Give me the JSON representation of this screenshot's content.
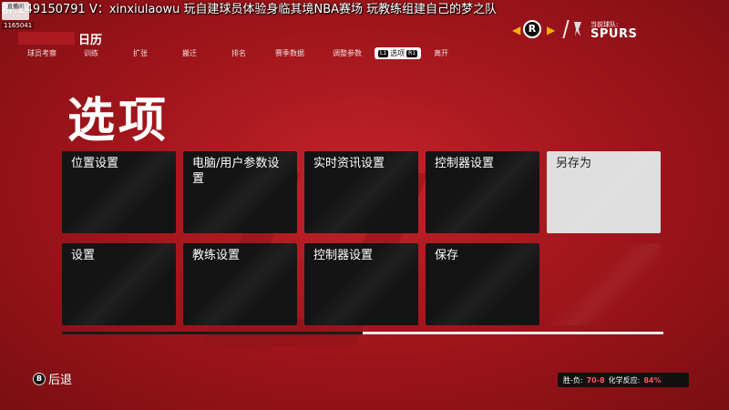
{
  "stream": {
    "banner": "群:249150791 V：xinxiulaowu   玩自建球员体验身临其境NBA赛场  玩教练组建自己的梦之队",
    "badge": "直播间",
    "room_id": "1165041"
  },
  "breadcrumb": {
    "current": "日历"
  },
  "nav": {
    "items": [
      {
        "label": "球员考察"
      },
      {
        "label": "训练"
      },
      {
        "label": "扩张"
      },
      {
        "label": "搬迁"
      },
      {
        "label": "排名"
      },
      {
        "label": "赛季数据"
      },
      {
        "label": "调整参数"
      },
      {
        "label": "选项",
        "active": true,
        "key_left": "L1",
        "key_right": "R1"
      },
      {
        "label": "离开"
      }
    ]
  },
  "team": {
    "label": "当前球队:",
    "name": "SPURS",
    "logo_letter": "R",
    "prev_arrow": "◀",
    "next_arrow": "▶"
  },
  "page": {
    "title": "选项"
  },
  "tiles": [
    {
      "label": "位置设置"
    },
    {
      "label": "电脑/用户参数设置"
    },
    {
      "label": "实时资讯设置"
    },
    {
      "label": "控制器设置"
    },
    {
      "label": "另存为",
      "selected": true
    },
    {
      "label": "设置"
    },
    {
      "label": "教练设置"
    },
    {
      "label": "控制器设置"
    },
    {
      "label": "保存"
    }
  ],
  "scroll_position": 0.5,
  "footer": {
    "back_key": "B",
    "back_label": "后退",
    "record_label": "胜-负:",
    "record_value": "70-8",
    "chemistry_label": "化学反应:",
    "chemistry_value": "84%"
  },
  "colors": {
    "accent": "#c12029",
    "tile_bg": "#141414",
    "selected_tile": "#dedede",
    "highlight_value": "#ff5560",
    "team_arrow": "#f2b300"
  }
}
